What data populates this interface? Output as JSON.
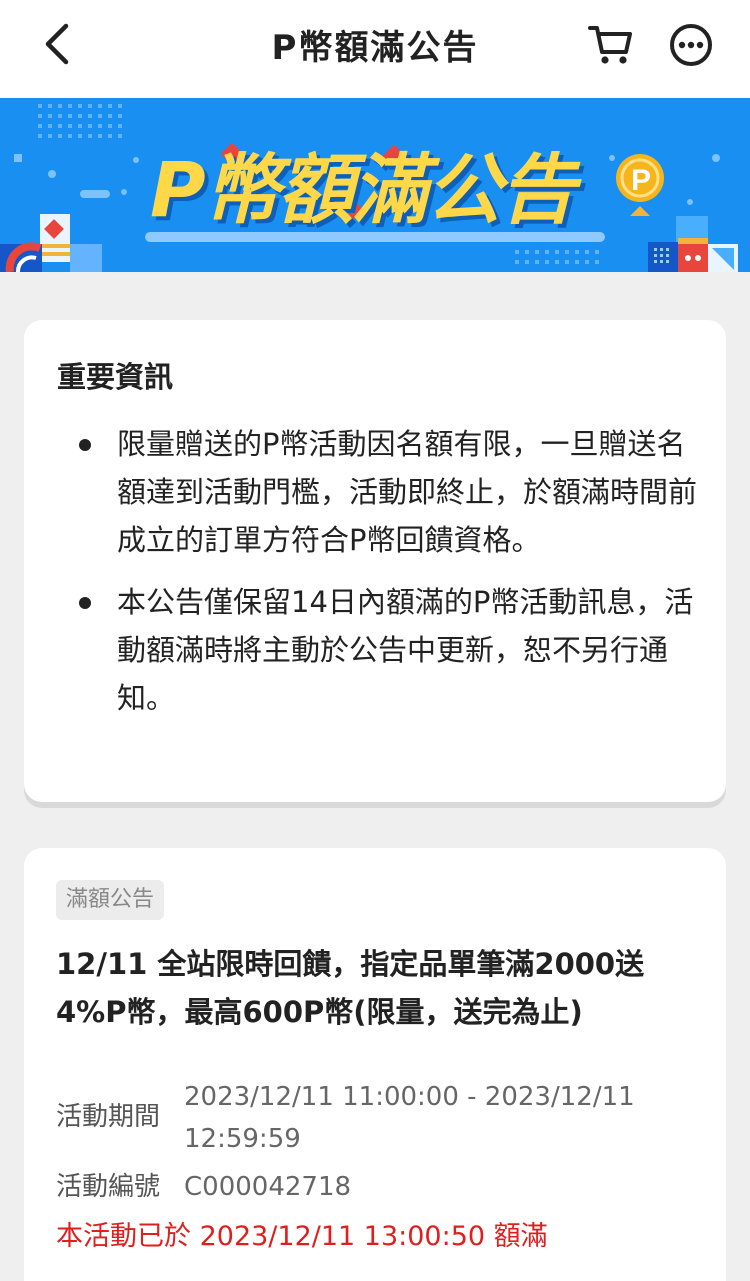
{
  "header": {
    "title": "P幣額滿公告",
    "back_icon": "chevron-left-icon",
    "cart_icon": "cart-icon",
    "more_icon": "more-horizontal-icon"
  },
  "banner": {
    "title": "P幣額滿公告",
    "coin_label": "P",
    "colors": {
      "background": "#1a8ff2",
      "title": "#ffd84a",
      "coin": "#f6b51b"
    }
  },
  "info": {
    "heading": "重要資訊",
    "items": [
      "限量贈送的P幣活動因名額有限，一旦贈送名額達到活動門檻，活動即終止，於額滿時間前成立的訂單方符合P幣回饋資格。",
      "本公告僅保留14日內額滿的P幣活動訊息，活動額滿時將主動於公告中更新，恕不另行通知。"
    ]
  },
  "notice": {
    "tag": "滿額公告",
    "title": "12/11 全站限時回饋，指定品單筆滿2000送4%P幣，最高600P幣(限量，送完為止)",
    "period_label": "活動期間",
    "period_value": "2023/12/11 11:00:00 - 2023/12/11 12:59:59",
    "code_label": "活動編號",
    "code_value": "C000042718",
    "full_text": "本活動已於 2023/12/11 13:00:50 額滿",
    "alert_color": "#e01e1e"
  }
}
